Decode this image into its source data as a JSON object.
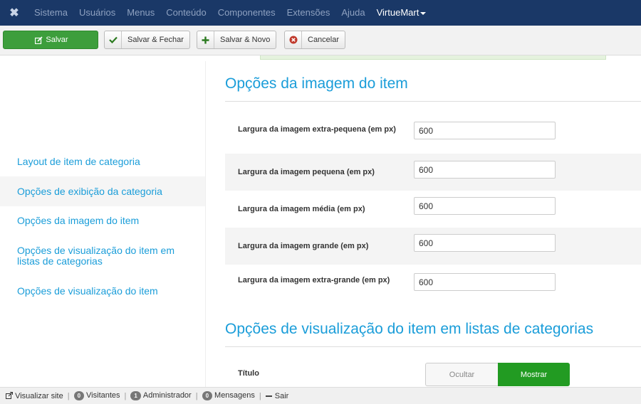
{
  "topnav": {
    "menu": [
      "Sistema",
      "Usuários",
      "Menus",
      "Conteúdo",
      "Componentes",
      "Extensões",
      "Ajuda"
    ],
    "brand": "VirtueMart"
  },
  "toolbar": {
    "save": "Salvar",
    "save_close": "Salvar & Fechar",
    "save_new": "Salvar & Novo",
    "cancel": "Cancelar"
  },
  "sidebar": {
    "items": [
      "Layout de item de categoria",
      "Opções de exibição da categoria",
      "Opções da imagem do item",
      "Opções de visualização do item em listas de categorias",
      "Opções de visualização do item"
    ]
  },
  "image_section": {
    "title": "Opções da imagem do item",
    "fields": [
      {
        "label": "Largura da imagem extra-pequena (em px)",
        "value": "600"
      },
      {
        "label": "Largura da imagem pequena (em px)",
        "value": "600"
      },
      {
        "label": "Largura da imagem média (em px)",
        "value": "600"
      },
      {
        "label": "Largura da imagem grande (em px)",
        "value": "600"
      },
      {
        "label": "Largura da imagem extra-grande (em px)",
        "value": "600"
      }
    ]
  },
  "list_section": {
    "title": "Opções de visualização do item em listas de categorias",
    "title_field": {
      "label": "Título",
      "off": "Ocultar",
      "on": "Mostrar"
    }
  },
  "status": {
    "view_site": "Visualizar site",
    "visitors_count": "0",
    "visitors": "Visitantes",
    "admin_count": "1",
    "admin": "Administrador",
    "messages_count": "0",
    "messages": "Mensagens",
    "logout": "Sair"
  }
}
